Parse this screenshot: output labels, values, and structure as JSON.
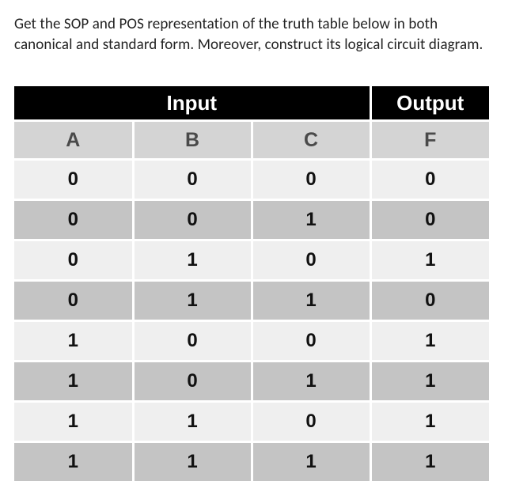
{
  "question": "Get the SOP and POS representation of the truth table below in both canonical and standard form. Moreover, construct its logical circuit diagram.",
  "chart_data": {
    "type": "table",
    "group_headers": [
      "Input",
      "Output"
    ],
    "columns": [
      "A",
      "B",
      "C",
      "F"
    ],
    "rows": [
      {
        "A": 0,
        "B": 0,
        "C": 0,
        "F": 0
      },
      {
        "A": 0,
        "B": 0,
        "C": 1,
        "F": 0
      },
      {
        "A": 0,
        "B": 1,
        "C": 0,
        "F": 1
      },
      {
        "A": 0,
        "B": 1,
        "C": 1,
        "F": 0
      },
      {
        "A": 1,
        "B": 0,
        "C": 0,
        "F": 1
      },
      {
        "A": 1,
        "B": 0,
        "C": 1,
        "F": 1
      },
      {
        "A": 1,
        "B": 1,
        "C": 0,
        "F": 1
      },
      {
        "A": 1,
        "B": 1,
        "C": 1,
        "F": 1
      }
    ]
  }
}
